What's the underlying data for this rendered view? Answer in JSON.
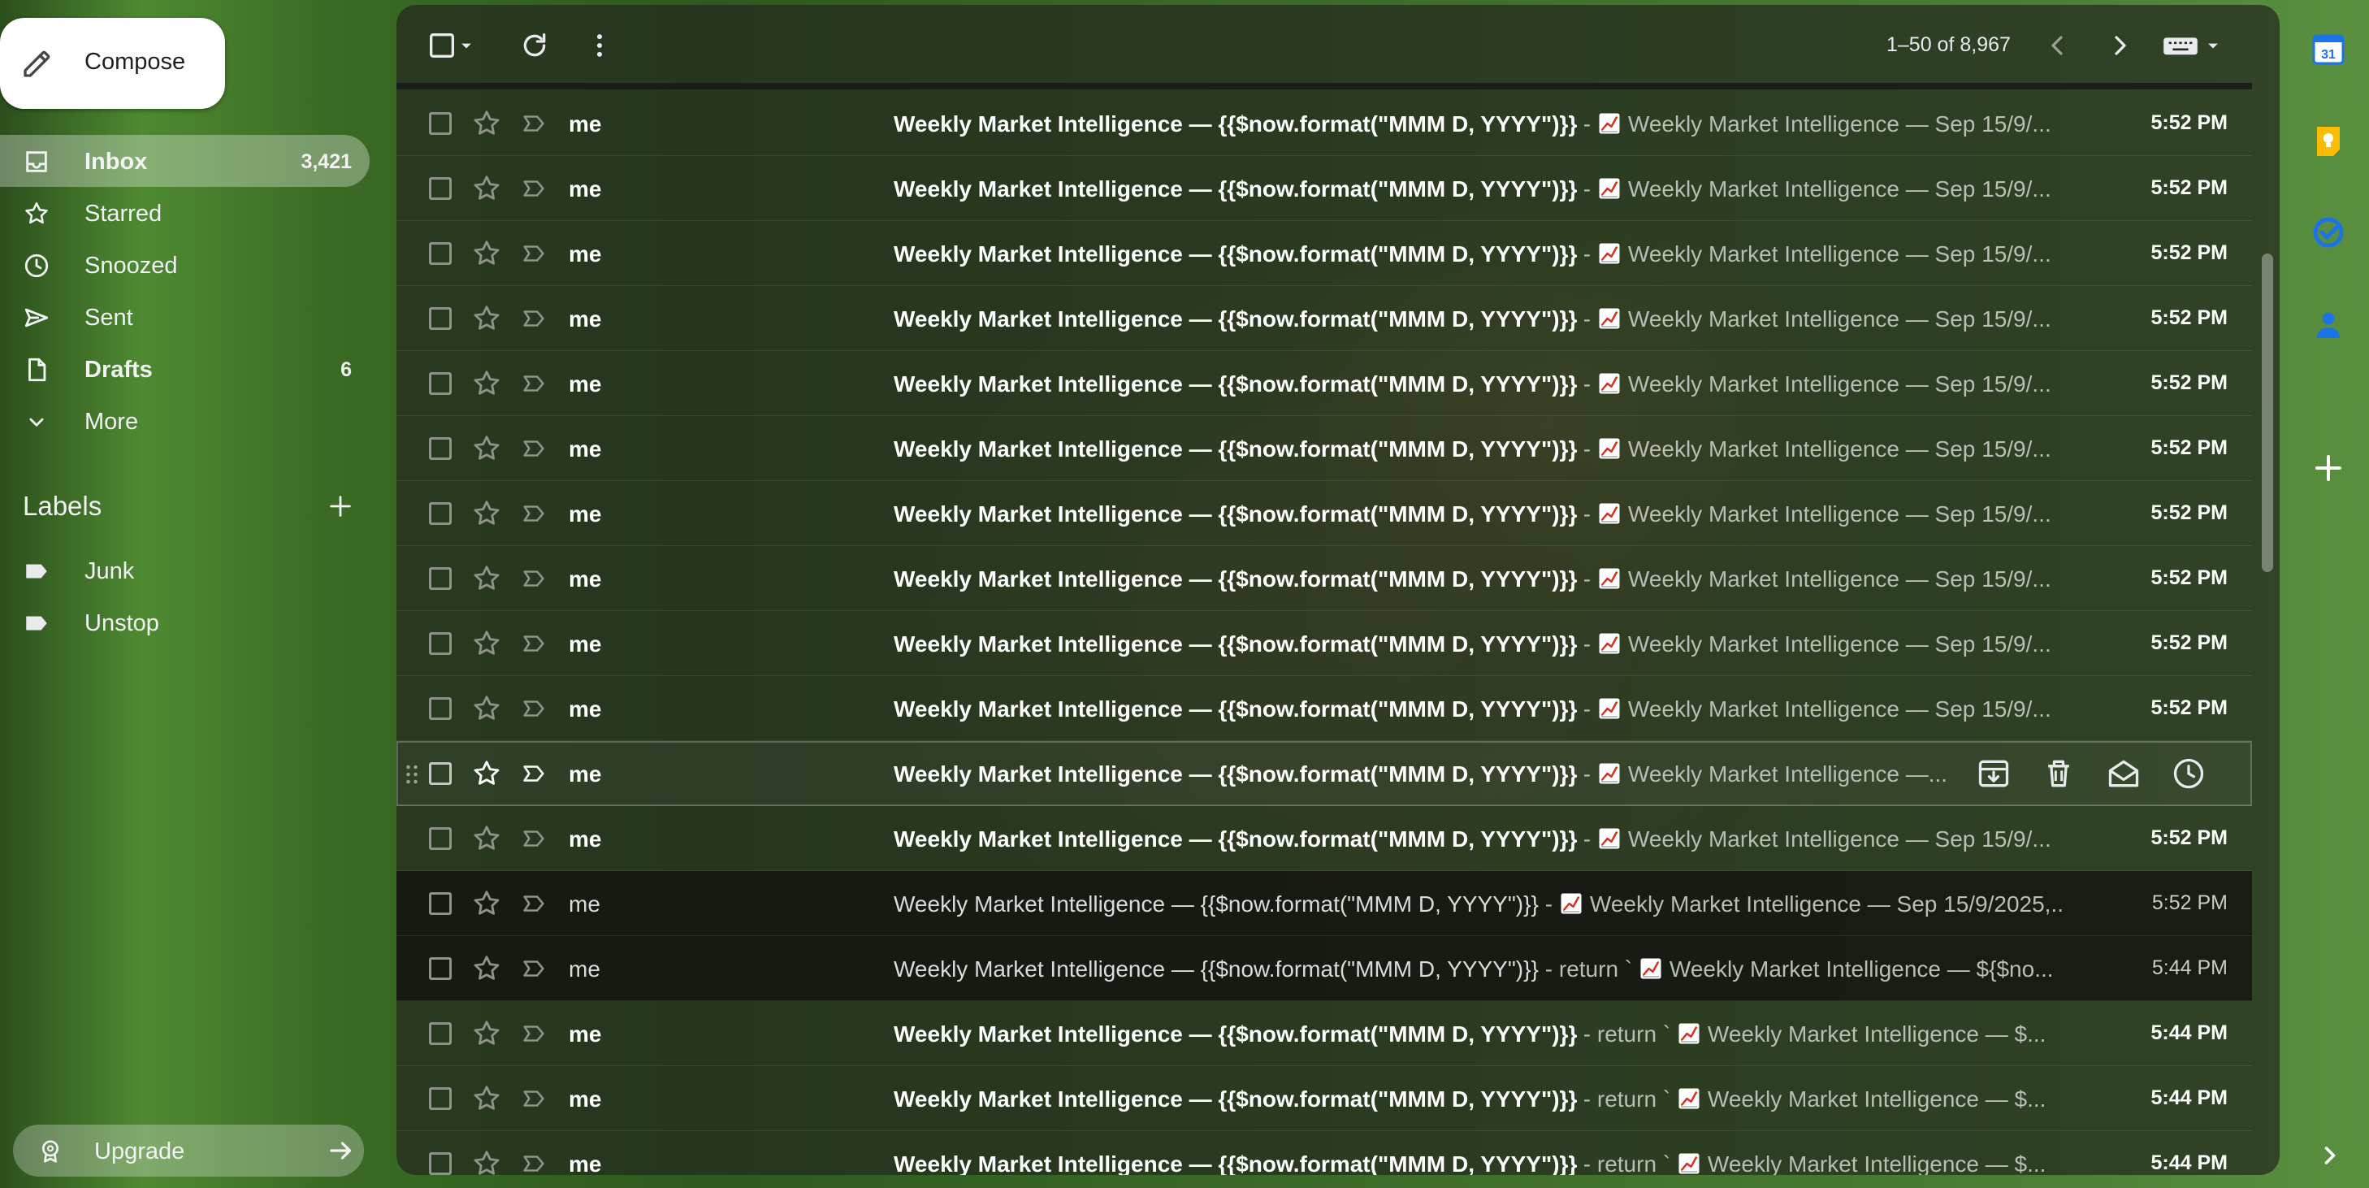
{
  "sidebar": {
    "compose_label": "Compose",
    "items": [
      {
        "label": "Inbox",
        "count": "3,421",
        "icon": "inbox-icon"
      },
      {
        "label": "Starred",
        "count": "",
        "icon": "star-icon"
      },
      {
        "label": "Snoozed",
        "count": "",
        "icon": "clock-icon"
      },
      {
        "label": "Sent",
        "count": "",
        "icon": "send-icon"
      },
      {
        "label": "Drafts",
        "count": "6",
        "icon": "draft-icon"
      },
      {
        "label": "More",
        "count": "",
        "icon": "chevron-down-icon"
      }
    ],
    "labels_heading": "Labels",
    "labels": [
      {
        "label": "Junk",
        "icon": "label-icon"
      },
      {
        "label": "Unstop",
        "icon": "label-icon"
      }
    ],
    "upgrade_label": "Upgrade"
  },
  "toolbar": {
    "page_count": "1–50 of 8,967"
  },
  "emails": [
    {
      "sender": "me",
      "subject": "Weekly Market Intelligence — {{$now.format(\"MMM D, YYYY\")}}",
      "separator": " - ",
      "snippet": "Weekly Market Intelligence — Sep 15/9/...",
      "time": "5:52 PM",
      "read": false
    },
    {
      "sender": "me",
      "subject": "Weekly Market Intelligence — {{$now.format(\"MMM D, YYYY\")}}",
      "separator": " - ",
      "snippet": "Weekly Market Intelligence — Sep 15/9/...",
      "time": "5:52 PM",
      "read": false
    },
    {
      "sender": "me",
      "subject": "Weekly Market Intelligence — {{$now.format(\"MMM D, YYYY\")}}",
      "separator": " - ",
      "snippet": "Weekly Market Intelligence — Sep 15/9/...",
      "time": "5:52 PM",
      "read": false
    },
    {
      "sender": "me",
      "subject": "Weekly Market Intelligence — {{$now.format(\"MMM D, YYYY\")}}",
      "separator": " - ",
      "snippet": "Weekly Market Intelligence — Sep 15/9/...",
      "time": "5:52 PM",
      "read": false
    },
    {
      "sender": "me",
      "subject": "Weekly Market Intelligence — {{$now.format(\"MMM D, YYYY\")}}",
      "separator": " - ",
      "snippet": "Weekly Market Intelligence — Sep 15/9/...",
      "time": "5:52 PM",
      "read": false
    },
    {
      "sender": "me",
      "subject": "Weekly Market Intelligence — {{$now.format(\"MMM D, YYYY\")}}",
      "separator": " - ",
      "snippet": "Weekly Market Intelligence — Sep 15/9/...",
      "time": "5:52 PM",
      "read": false
    },
    {
      "sender": "me",
      "subject": "Weekly Market Intelligence — {{$now.format(\"MMM D, YYYY\")}}",
      "separator": " - ",
      "snippet": "Weekly Market Intelligence — Sep 15/9/...",
      "time": "5:52 PM",
      "read": false
    },
    {
      "sender": "me",
      "subject": "Weekly Market Intelligence — {{$now.format(\"MMM D, YYYY\")}}",
      "separator": " - ",
      "snippet": "Weekly Market Intelligence — Sep 15/9/...",
      "time": "5:52 PM",
      "read": false
    },
    {
      "sender": "me",
      "subject": "Weekly Market Intelligence — {{$now.format(\"MMM D, YYYY\")}}",
      "separator": " - ",
      "snippet": "Weekly Market Intelligence — Sep 15/9/...",
      "time": "5:52 PM",
      "read": false
    },
    {
      "sender": "me",
      "subject": "Weekly Market Intelligence — {{$now.format(\"MMM D, YYYY\")}}",
      "separator": " - ",
      "snippet": "Weekly Market Intelligence — Sep 15/9/...",
      "time": "5:52 PM",
      "read": false
    },
    {
      "sender": "me",
      "subject": "Weekly Market Intelligence — {{$now.format(\"MMM D, YYYY\")}}",
      "separator": " - ",
      "snippet": "Weekly Market Intelligence —...",
      "time": "",
      "read": false,
      "hover": true
    },
    {
      "sender": "me",
      "subject": "Weekly Market Intelligence — {{$now.format(\"MMM D, YYYY\")}}",
      "separator": " - ",
      "snippet": "Weekly Market Intelligence — Sep 15/9/...",
      "time": "5:52 PM",
      "read": false
    },
    {
      "sender": "me",
      "subject": "Weekly Market Intelligence — {{$now.format(\"MMM D, YYYY\")}}",
      "separator": " - ",
      "snippet": "Weekly Market Intelligence — Sep 15/9/2025,...",
      "time": "5:52 PM",
      "read": true
    },
    {
      "sender": "me",
      "subject": "Weekly Market Intelligence — {{$now.format(\"MMM D, YYYY\")}}",
      "separator": " - return ` ",
      "snippet": "Weekly Market Intelligence — ${$no...",
      "time": "5:44 PM",
      "read": true
    },
    {
      "sender": "me",
      "subject": "Weekly Market Intelligence — {{$now.format(\"MMM D, YYYY\")}}",
      "separator": " - return ` ",
      "snippet": "Weekly Market Intelligence — $...",
      "time": "5:44 PM",
      "read": false
    },
    {
      "sender": "me",
      "subject": "Weekly Market Intelligence — {{$now.format(\"MMM D, YYYY\")}}",
      "separator": " - return ` ",
      "snippet": "Weekly Market Intelligence — $...",
      "time": "5:44 PM",
      "read": false
    },
    {
      "sender": "me",
      "subject": "Weekly Market Intelligence — {{$now.format(\"MMM D, YYYY\")}}",
      "separator": " - return ` ",
      "snippet": "Weekly Market Intelligence — $...",
      "time": "5:44 PM",
      "read": false
    }
  ],
  "hover_actions": [
    "archive-icon",
    "delete-icon",
    "mark-read-icon",
    "snooze-icon"
  ],
  "side_panel": {
    "calendar_day": "31",
    "icons": [
      "calendar-icon",
      "keep-icon",
      "tasks-icon",
      "contacts-icon",
      "add-icon"
    ]
  },
  "colors": {
    "panel_bg": "#22281e",
    "read_row_bg": "#121210",
    "accent_calendar": "#1a73e8",
    "accent_keep": "#fbbc04",
    "accent_tasks": "#1a73e8"
  }
}
